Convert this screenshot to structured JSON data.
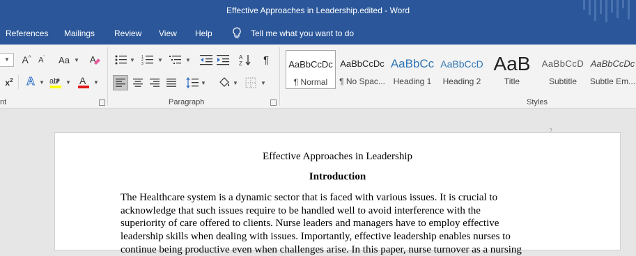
{
  "window": {
    "title": "Effective Approaches in Leadership.edited  -  Word"
  },
  "tabs": [
    "References",
    "Mailings",
    "Review",
    "View",
    "Help"
  ],
  "tell_me": "Tell me what you want to do",
  "groups": {
    "font": "nt",
    "paragraph": "Paragraph",
    "styles": "Styles"
  },
  "styles": [
    {
      "sample": "AaBbCcDc",
      "name": "¶ Normal"
    },
    {
      "sample": "AaBbCcDc",
      "name": "¶ No Spac..."
    },
    {
      "sample": "AaBbCc",
      "name": "Heading 1"
    },
    {
      "sample": "AaBbCcD",
      "name": "Heading 2"
    },
    {
      "sample": "AaB",
      "name": "Title"
    },
    {
      "sample": "AaBbCcD",
      "name": "Subtitle"
    },
    {
      "sample": "AaBbCcDc",
      "name": "Subtle Em..."
    }
  ],
  "document": {
    "page_number": "2",
    "title": "Effective Approaches in Leadership",
    "heading": "Introduction",
    "lines": [
      "The Healthcare system is a dynamic sector that is faced with various issues. It is crucial to",
      "acknowledge that such issues require to be handled well to avoid interference with the",
      "superiority of care offered to clients. Nurse leaders and managers have to employ effective",
      "leadership skills when dealing with issues. Importantly, effective leadership enables nurses to",
      "continue being productive even when challenges arise. In this paper, nurse turnover as a nursing"
    ]
  },
  "colors": {
    "ribbon_blue": "#2b579a",
    "highlight_yellow": "#ffff00",
    "font_color_red": "#e21b1b",
    "text_effects_blue": "#2b6cc4",
    "heading_blue": "#2e74b5"
  },
  "icons": {
    "font_size_box": "dropdown",
    "grow_font": "A^",
    "shrink_font": "A^",
    "change_case": "Aa",
    "clear_formatting": "eraser",
    "superscript": "x²",
    "text_effects": "A outline",
    "highlight": "ab marker",
    "font_color": "A red",
    "bullets": "list-bullets",
    "numbering": "list-numbers",
    "multilevel": "list-multilevel",
    "decrease_indent": "indent-decrease",
    "increase_indent": "indent-increase",
    "sort": "A-Z sort",
    "show_marks": "pilcrow",
    "align_left": "align-left",
    "center": "align-center",
    "align_right": "align-right",
    "justify": "justify",
    "line_spacing": "line-spacing",
    "shading": "paint-bucket",
    "borders": "borders",
    "lightbulb": "lightbulb"
  }
}
